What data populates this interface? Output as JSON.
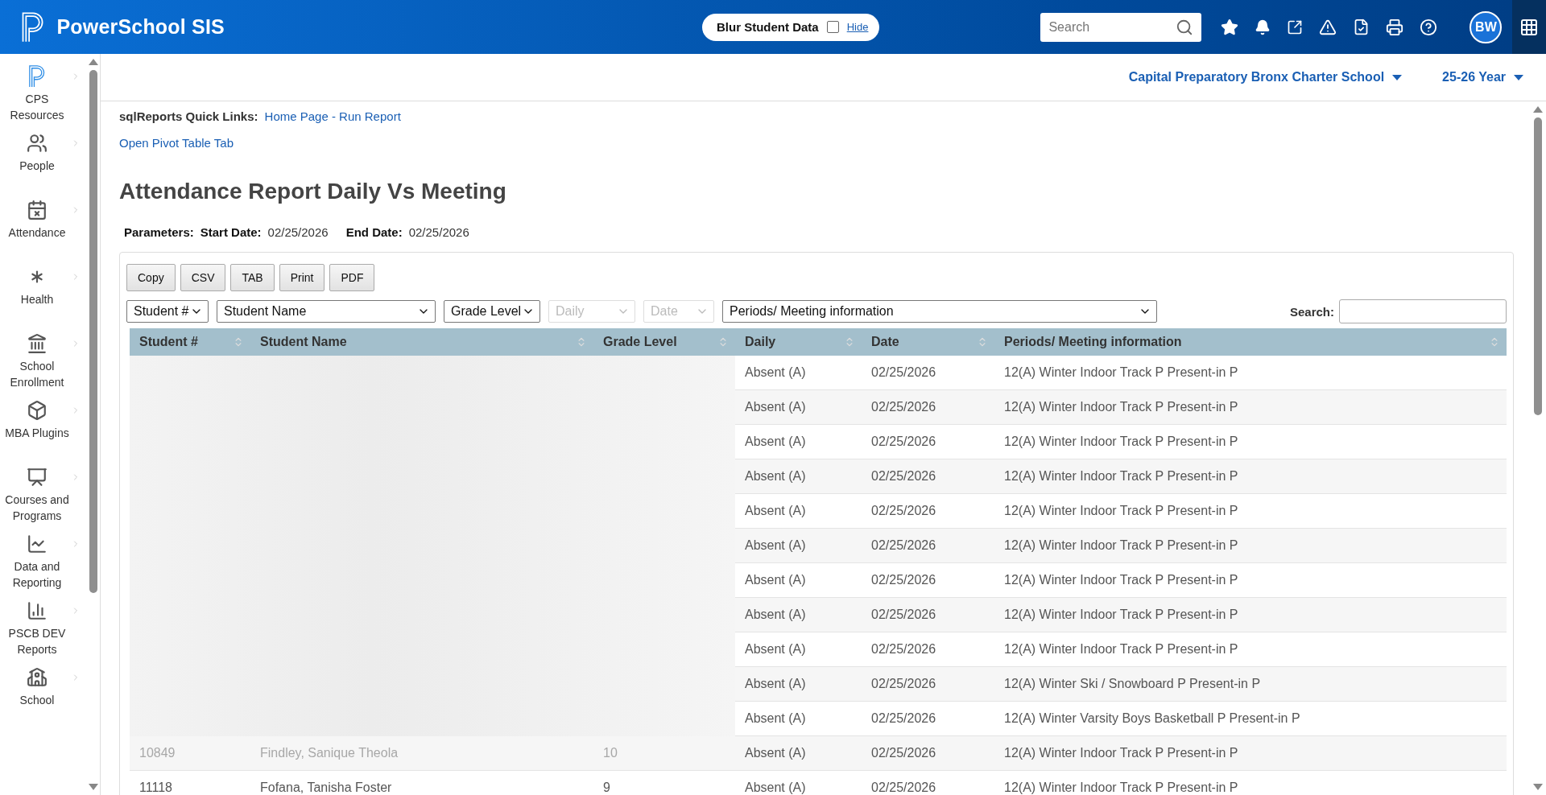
{
  "app": {
    "name": "PowerSchool SIS"
  },
  "blur_toggle": {
    "label": "Blur Student Data",
    "checked": false,
    "link": "Hide"
  },
  "search": {
    "placeholder": "Search"
  },
  "user": {
    "initials": "BW"
  },
  "sidebar": {
    "items": [
      {
        "label": "CPS Resources"
      },
      {
        "label": "People"
      },
      {
        "label": "Attendance"
      },
      {
        "label": "Health"
      },
      {
        "label": "School Enrollment"
      },
      {
        "label": "MBA Plugins"
      },
      {
        "label": "Courses and Programs"
      },
      {
        "label": "Data and Reporting"
      },
      {
        "label": "PSCB DEV Reports"
      },
      {
        "label": "School"
      }
    ]
  },
  "context": {
    "school": "Capital Preparatory Bronx Charter School",
    "year": "25-26 Year"
  },
  "quick_links": {
    "label": "sqlReports Quick Links:",
    "link": "Home Page - Run Report"
  },
  "pivot_link": "Open Pivot Table Tab",
  "title": "Attendance Report Daily Vs Meeting",
  "parameters": {
    "label": "Parameters:",
    "start_label": "Start Date:",
    "start": "02/25/2026",
    "end_label": "End Date:",
    "end": "02/25/2026"
  },
  "export_buttons": [
    "Copy",
    "CSV",
    "TAB",
    "Print",
    "PDF"
  ],
  "filters": [
    {
      "label": "Student #",
      "disabled": false
    },
    {
      "label": "Student Name",
      "disabled": false
    },
    {
      "label": "Grade Level",
      "disabled": false
    },
    {
      "label": "Daily",
      "disabled": true
    },
    {
      "label": "Date",
      "disabled": true
    },
    {
      "label": "Periods/ Meeting information",
      "disabled": false
    }
  ],
  "table_search": {
    "label": "Search:"
  },
  "table": {
    "columns": [
      "Student #",
      "Student Name",
      "Grade Level",
      "Daily",
      "Date",
      "Periods/ Meeting information"
    ],
    "rows": [
      {
        "blurred": true,
        "daily": "Absent (A)",
        "date": "02/25/2026",
        "periods": "12(A) Winter Indoor Track P Present-in P"
      },
      {
        "blurred": true,
        "daily": "Absent (A)",
        "date": "02/25/2026",
        "periods": "12(A) Winter Indoor Track P Present-in P"
      },
      {
        "blurred": true,
        "daily": "Absent (A)",
        "date": "02/25/2026",
        "periods": "12(A) Winter Indoor Track P Present-in P"
      },
      {
        "blurred": true,
        "daily": "Absent (A)",
        "date": "02/25/2026",
        "periods": "12(A) Winter Indoor Track P Present-in P"
      },
      {
        "blurred": true,
        "daily": "Absent (A)",
        "date": "02/25/2026",
        "periods": "12(A) Winter Indoor Track P Present-in P"
      },
      {
        "blurred": true,
        "daily": "Absent (A)",
        "date": "02/25/2026",
        "periods": "12(A) Winter Indoor Track P Present-in P"
      },
      {
        "blurred": true,
        "daily": "Absent (A)",
        "date": "02/25/2026",
        "periods": "12(A) Winter Indoor Track P Present-in P"
      },
      {
        "blurred": true,
        "daily": "Absent (A)",
        "date": "02/25/2026",
        "periods": "12(A) Winter Indoor Track P Present-in P"
      },
      {
        "blurred": true,
        "daily": "Absent (A)",
        "date": "02/25/2026",
        "periods": "12(A) Winter Indoor Track P Present-in P"
      },
      {
        "blurred": true,
        "daily": "Absent (A)",
        "date": "02/25/2026",
        "periods": "12(A) Winter Ski / Snowboard P Present-in P"
      },
      {
        "blurred": true,
        "daily": "Absent (A)",
        "date": "02/25/2026",
        "periods": "12(A) Winter Varsity Boys Basketball P Present-in P"
      },
      {
        "blurred": false,
        "faded": true,
        "student_no": "10849",
        "name": "Findley, Sanique Theola",
        "grade": "10",
        "daily": "Absent (A)",
        "date": "02/25/2026",
        "periods": "12(A) Winter Indoor Track P Present-in P"
      },
      {
        "blurred": false,
        "faded": false,
        "student_no": "11118",
        "name": "Fofana, Tanisha Foster",
        "grade": "9",
        "daily": "Absent (A)",
        "date": "02/25/2026",
        "periods": "12(A) Winter Indoor Track P Present-in P"
      }
    ]
  }
}
